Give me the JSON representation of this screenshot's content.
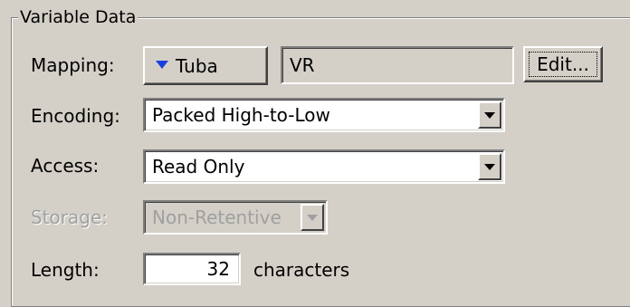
{
  "group": {
    "title": "Variable Data"
  },
  "mapping": {
    "label": "Mapping:",
    "button_label": "Tuba",
    "button_icon": "dropdown-triangle-icon",
    "value": "VR",
    "edit_label": "Edit..."
  },
  "encoding": {
    "label": "Encoding:",
    "selected": "Packed High-to-Low"
  },
  "access": {
    "label": "Access:",
    "selected": "Read Only"
  },
  "storage": {
    "label": "Storage:",
    "selected": "Non-Retentive",
    "enabled": false
  },
  "length": {
    "label": "Length:",
    "value": "32",
    "unit": "characters"
  },
  "colors": {
    "dialog_background": "#d4d0c8",
    "mapping_icon": "#1a3fe0",
    "disabled_text": "#a0a0a0"
  }
}
